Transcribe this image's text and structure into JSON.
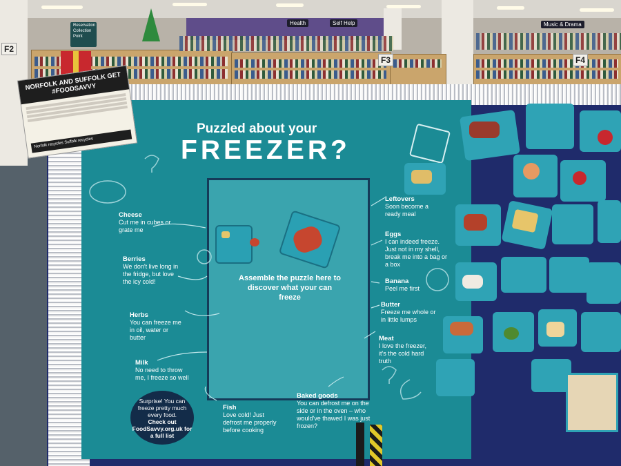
{
  "library_signs": {
    "zone_left": "F2",
    "zone_mid": "F3",
    "zone_right": "F4",
    "reservation_sign": "Reservation Collection Point",
    "category_sign": "Music & Drama",
    "shelf_sign_1": "Health",
    "shelf_sign_2": "Self Help"
  },
  "food_sign": {
    "title": "NORFOLK AND SUFFOLK GET #FOODSAVVY",
    "footer": "Norfolk recycles   Suffolk recycles"
  },
  "board": {
    "title_small": "Puzzled about your",
    "title_large": "FREEZER?",
    "center_text": "Assemble the puzzle here to discover what your can freeze",
    "surprise": {
      "line1": "Surprise! You can freeze pretty much every food.",
      "line2": "Check out FoodSavvy.org.uk for a full list"
    },
    "left_items": [
      {
        "name": "Cheese",
        "text": "Cut me in cubes or grate me"
      },
      {
        "name": "Berries",
        "text": "We don't live long in the fridge, but love the icy cold!"
      },
      {
        "name": "Herbs",
        "text": "You can freeze me in oil, water or butter"
      },
      {
        "name": "Milk",
        "text": "No need to throw me, I freeze so well"
      }
    ],
    "right_items": [
      {
        "name": "Leftovers",
        "text": "Soon become a ready meal"
      },
      {
        "name": "Eggs",
        "text": "I can indeed freeze. Just not in my shell, break me into a bag or a box"
      },
      {
        "name": "Banana",
        "text": "Peel me first"
      },
      {
        "name": "Butter",
        "text": "Freeze me whole or in little lumps"
      },
      {
        "name": "Meat",
        "text": "I love the freezer, it's the cold hard truth"
      }
    ],
    "bottom_items": [
      {
        "name": "Fish",
        "text": "Love cold! Just defrost me properly before cooking"
      },
      {
        "name": "Baked goods",
        "text": "You can defrost me on the side or in the oven – who would've thawed I was just frozen?"
      }
    ]
  },
  "colors": {
    "board_navy": "#1f2b6b",
    "panel_teal": "#1b8b95",
    "puzzle_teal": "#2fa3b5",
    "surprise_navy": "#132c49"
  }
}
